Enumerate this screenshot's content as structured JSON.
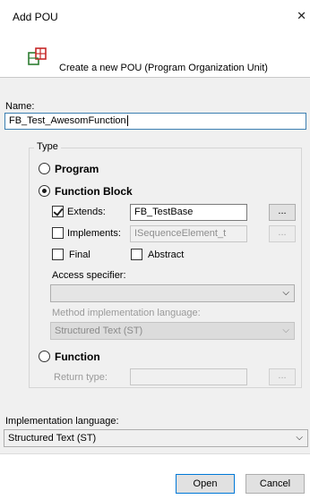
{
  "dialog": {
    "title": "Add POU",
    "close_glyph": "✕"
  },
  "header": {
    "icon": "pou-icon",
    "text": "Create a new POU (Program Organization Unit)"
  },
  "name": {
    "label": "Name:",
    "value": "FB_Test_AwesomFunction"
  },
  "type_group": {
    "title": "Type",
    "program": {
      "label": "Program",
      "selected": false
    },
    "function_block": {
      "label": "Function Block",
      "selected": true,
      "extends": {
        "label": "Extends:",
        "checked": true,
        "value": "FB_TestBase",
        "browse": "..."
      },
      "implements": {
        "label": "Implements:",
        "checked": false,
        "value": "ISequenceElement_t",
        "browse": "..."
      },
      "final": {
        "label": "Final",
        "checked": false
      },
      "abstract": {
        "label": "Abstract",
        "checked": false
      },
      "access_specifier": {
        "label": "Access specifier:",
        "value": ""
      },
      "method_impl_lang": {
        "label": "Method implementation language:",
        "value": "Structured Text (ST)"
      }
    },
    "function": {
      "label": "Function",
      "selected": false,
      "return_type": {
        "label": "Return type:",
        "value": "",
        "browse": "..."
      }
    }
  },
  "implementation_language": {
    "label": "Implementation language:",
    "value": "Structured Text (ST)"
  },
  "buttons": {
    "open": "Open",
    "cancel": "Cancel"
  }
}
